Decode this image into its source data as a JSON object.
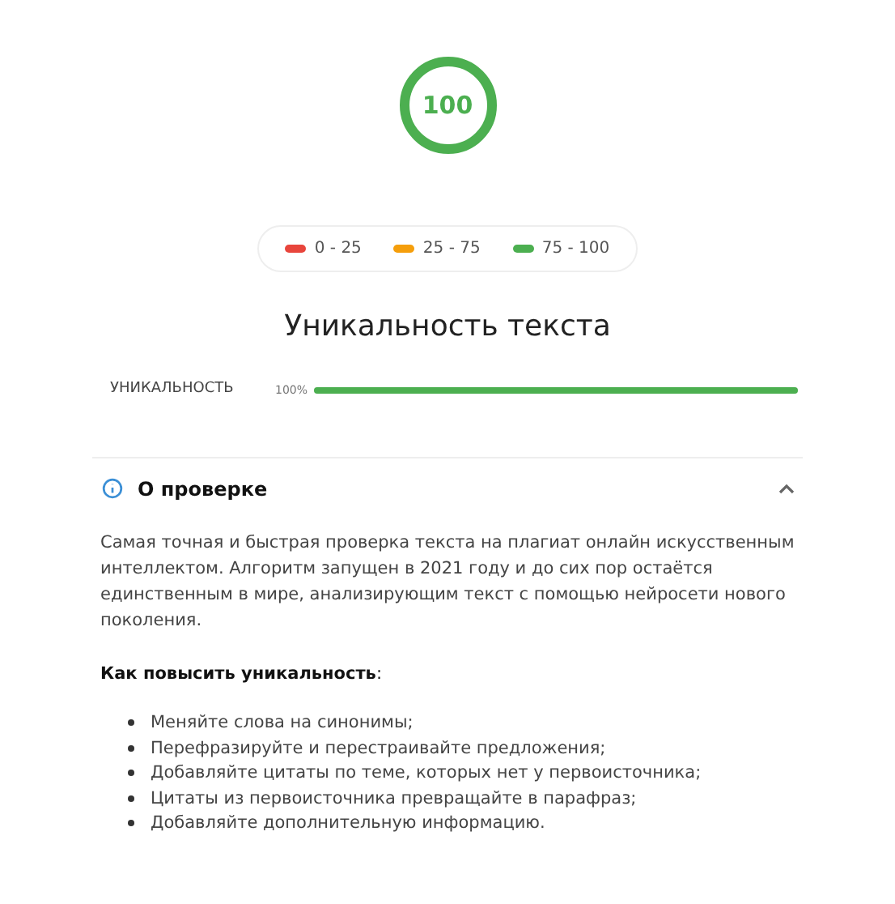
{
  "score": {
    "value": "100"
  },
  "legend": [
    {
      "label": "0 - 25",
      "color": "#e8453c"
    },
    {
      "label": "25 - 75",
      "color": "#f59e0b"
    },
    {
      "label": "75 - 100",
      "color": "#4caf50"
    }
  ],
  "title": "Уникальность текста",
  "meter": {
    "label": "УНИКАЛЬНОСТЬ",
    "reading": "100%",
    "level": 1
  },
  "about": {
    "title": "О проверке",
    "expanded": true,
    "paragraph": "Самая точная и быстрая проверка текста на плагиат онлайн искусственным интеллектом. Алгоритм запущен в 2021 году и до сих пор остаётся единственным в мире, анализирующим текст с помощью нейросети нового поколения.",
    "subheading": "**Как повысить уникальность**:",
    "tips": [
      "Меняйте слова на синонимы;",
      "Перефразируйте и перестраивайте предложения;",
      "Добавляйте цитаты по теме, которых нет у первоисточника;",
      "Цитаты из первоисточника превращайте в парафраз;",
      "Добавляйте дополнительную информацию."
    ]
  }
}
